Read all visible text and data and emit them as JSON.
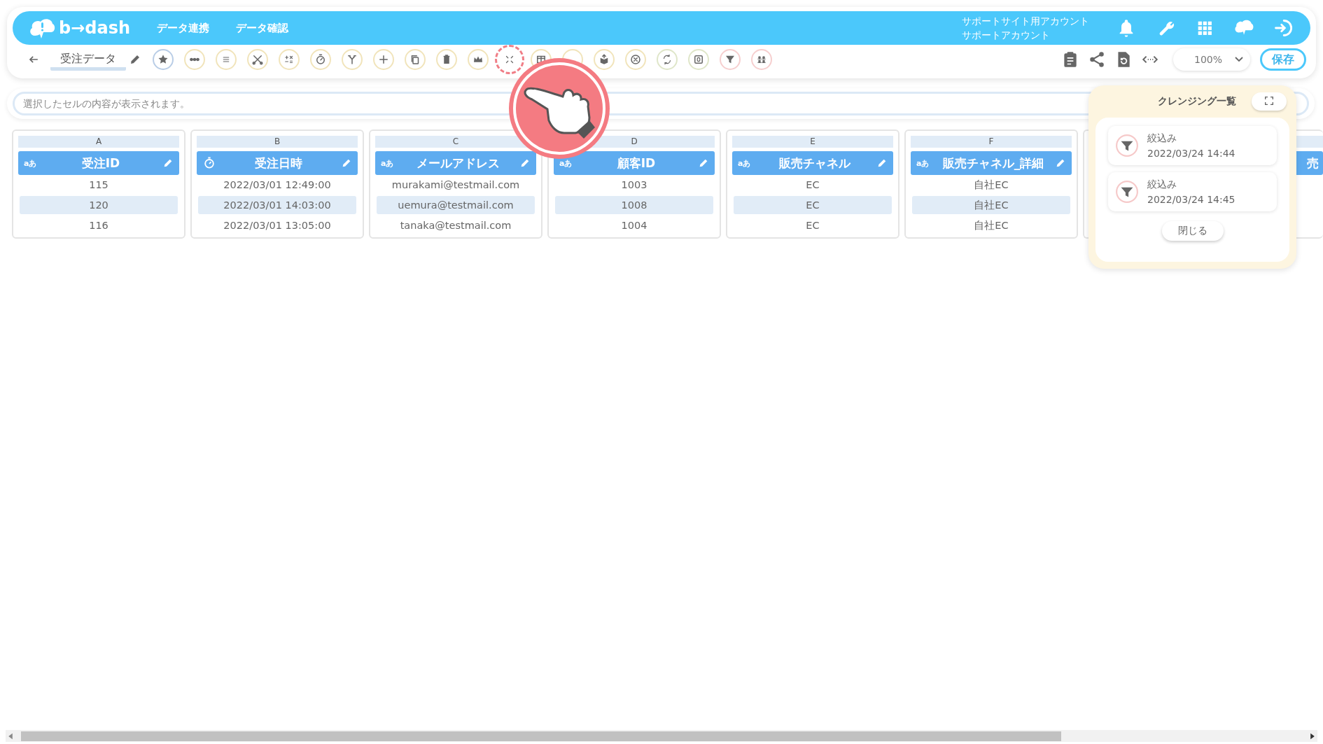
{
  "header": {
    "logo": "b→dash",
    "nav": [
      "データ連携",
      "データ確認"
    ],
    "account": [
      "サポートサイト用アカウント",
      "サポートアカウント"
    ]
  },
  "toolbar": {
    "title": "受注データ",
    "tools": [
      {
        "kind": "star",
        "color": "#b9cde6",
        "highlighted": false
      },
      {
        "kind": "dots",
        "color": "#f1e4bb",
        "highlighted": false
      },
      {
        "kind": "lines",
        "color": "#f1e4bb",
        "highlighted": false
      },
      {
        "kind": "scissors",
        "color": "#f1e4bb",
        "highlighted": false
      },
      {
        "kind": "calc",
        "color": "#f1e4bb",
        "highlighted": false
      },
      {
        "kind": "stopwatch",
        "color": "#f1e4bb",
        "highlighted": false
      },
      {
        "kind": "branch",
        "color": "#f1e4bb",
        "highlighted": false
      },
      {
        "kind": "plus",
        "color": "#f1e4bb",
        "highlighted": false
      },
      {
        "kind": "copy",
        "color": "#f1e4bb",
        "highlighted": false
      },
      {
        "kind": "trash",
        "color": "#f1e4bb",
        "highlighted": false
      },
      {
        "kind": "crown",
        "color": "#f1e4bb",
        "highlighted": false
      },
      {
        "kind": "compress",
        "color": "#f07d86",
        "highlighted": true
      },
      {
        "kind": "table",
        "color": "#f1e4bb",
        "highlighted": false
      },
      {
        "kind": "covered",
        "color": "#f1e4bb",
        "highlighted": false
      },
      {
        "kind": "box",
        "color": "#f1e4bb",
        "highlighted": false
      },
      {
        "kind": "xcircle",
        "color": "#f1e4bb",
        "highlighted": false
      },
      {
        "kind": "swap",
        "color": "#dfe6c9",
        "highlighted": false
      },
      {
        "kind": "zero",
        "color": "#dfe6c9",
        "highlighted": false
      },
      {
        "kind": "filter",
        "color": "#f6cfcf",
        "highlighted": false
      },
      {
        "kind": "people",
        "color": "#f6cfcf",
        "highlighted": false
      }
    ],
    "zoom": "100%",
    "save": "保存"
  },
  "formula_bar": {
    "placeholder": "選択したセルの内容が表示されます。"
  },
  "columns": [
    {
      "letter": "A",
      "kind": "text",
      "type_label": "aあ",
      "name": "受注ID",
      "cells": [
        "115",
        "120",
        "116"
      ]
    },
    {
      "letter": "B",
      "kind": "datetime",
      "name": "受注日時",
      "cells": [
        "2022/03/01 12:49:00",
        "2022/03/01 14:03:00",
        "2022/03/01 13:05:00"
      ]
    },
    {
      "letter": "C",
      "kind": "text",
      "type_label": "aあ",
      "name": "メールアドレス",
      "cells": [
        "murakami@testmail.com",
        "uemura@testmail.com",
        "tanaka@testmail.com"
      ]
    },
    {
      "letter": "D",
      "kind": "text",
      "type_label": "aあ",
      "name": "顧客ID",
      "cells": [
        "1003",
        "1008",
        "1004"
      ]
    },
    {
      "letter": "E",
      "kind": "text",
      "type_label": "aあ",
      "name": "販売チャネル",
      "cells": [
        "EC",
        "EC",
        "EC"
      ]
    },
    {
      "letter": "F",
      "kind": "text",
      "type_label": "aあ",
      "name": "販売チャネル_詳細",
      "cells": [
        "自社EC",
        "自社EC",
        "自社EC"
      ]
    },
    {
      "kind": "partial",
      "name": "売"
    }
  ],
  "cleansing_panel": {
    "title": "クレンジング一覧",
    "items": [
      {
        "kind": "filter",
        "label": "絞込み",
        "date": "2022/03/24 14:44"
      },
      {
        "kind": "filter",
        "label": "絞込み",
        "date": "2022/03/24 14:45"
      }
    ],
    "close": "閉じる"
  }
}
